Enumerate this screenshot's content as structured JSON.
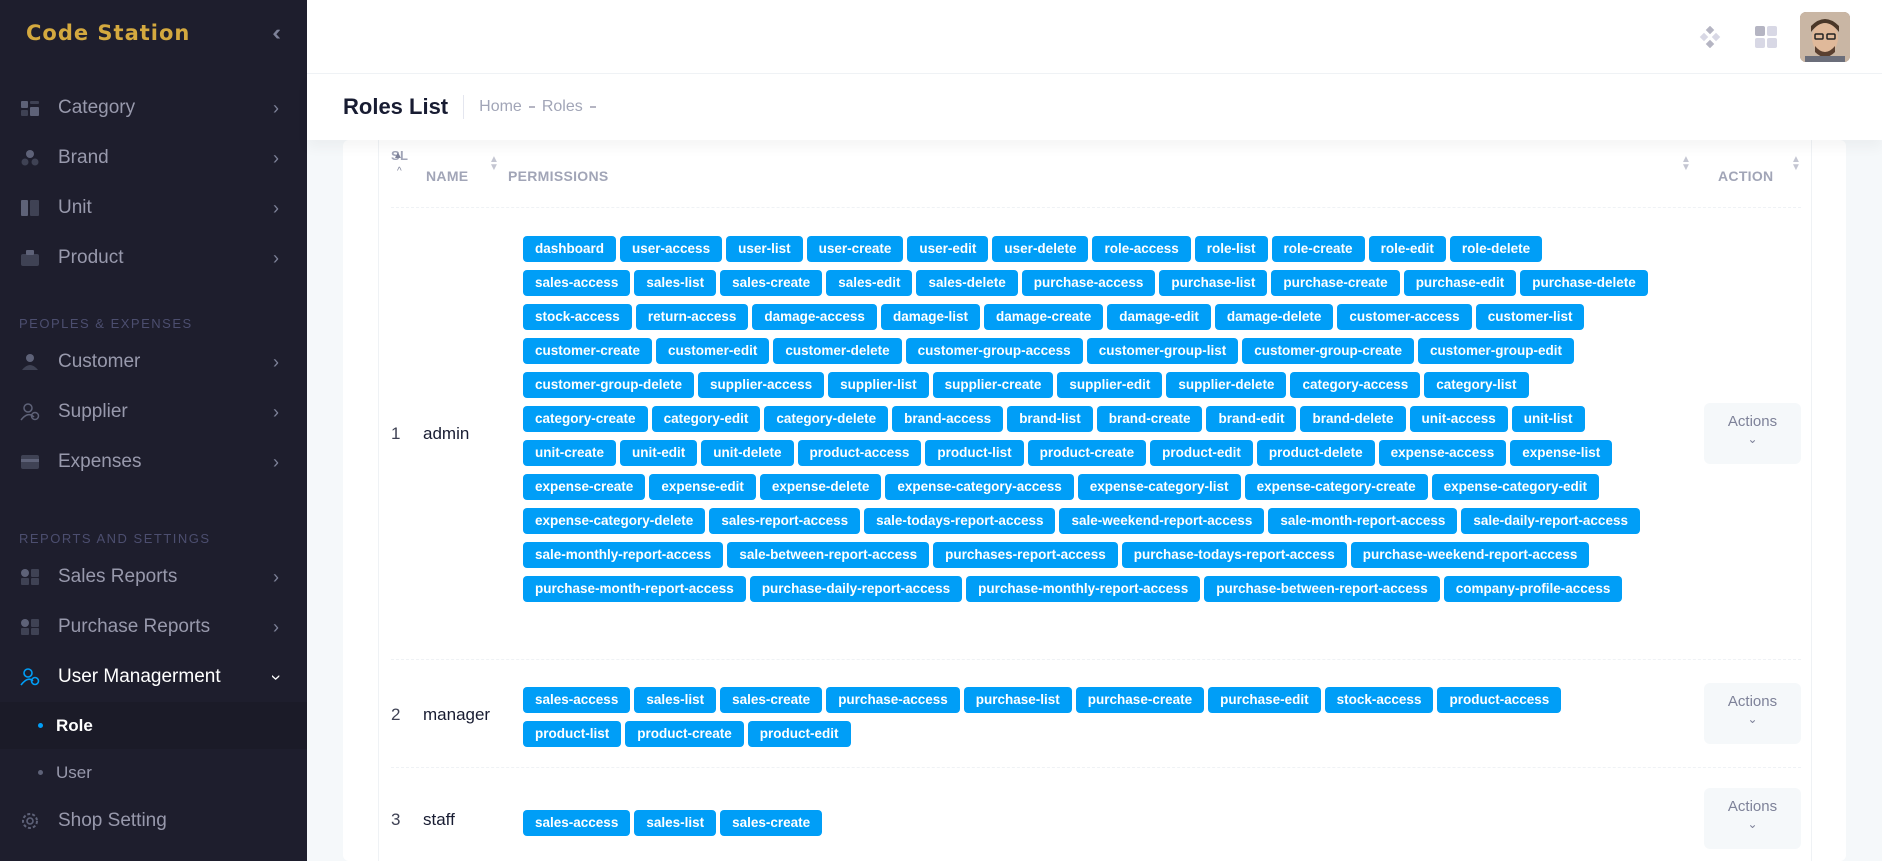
{
  "app": {
    "logo": "Code Station"
  },
  "sidebar": {
    "top_items": [
      {
        "label": "Category",
        "icon": "category-icon"
      },
      {
        "label": "Brand",
        "icon": "brand-icon"
      },
      {
        "label": "Unit",
        "icon": "unit-icon"
      },
      {
        "label": "Product",
        "icon": "product-icon"
      }
    ],
    "section1": "PEOPLES & EXPENSES",
    "people_items": [
      {
        "label": "Customer",
        "icon": "customer-icon"
      },
      {
        "label": "Supplier",
        "icon": "supplier-icon"
      },
      {
        "label": "Expenses",
        "icon": "expenses-icon"
      }
    ],
    "section2": "REPORTS AND SETTINGS",
    "report_items": [
      {
        "label": "Sales Reports",
        "icon": "sales-reports-icon"
      },
      {
        "label": "Purchase Reports",
        "icon": "purchase-reports-icon"
      }
    ],
    "user_management": {
      "label": "User Managerment",
      "sub": [
        {
          "label": "Role",
          "active": true
        },
        {
          "label": "User",
          "active": false
        }
      ]
    },
    "shop_setting": "Shop Setting"
  },
  "toolbar": {
    "title": "Roles List",
    "breadcrumb": [
      "Home",
      "Roles"
    ]
  },
  "table": {
    "headers": {
      "sl": "SL",
      "name": "NAME",
      "permissions": "PERMISSIONS",
      "action": "ACTION"
    },
    "action_label": "Actions",
    "rows": [
      {
        "sl": "1",
        "name": "admin",
        "permissions": [
          "dashboard",
          "user-access",
          "user-list",
          "user-create",
          "user-edit",
          "user-delete",
          "role-access",
          "role-list",
          "role-create",
          "role-edit",
          "role-delete",
          "sales-access",
          "sales-list",
          "sales-create",
          "sales-edit",
          "sales-delete",
          "purchase-access",
          "purchase-list",
          "purchase-create",
          "purchase-edit",
          "purchase-delete",
          "stock-access",
          "return-access",
          "damage-access",
          "damage-list",
          "damage-create",
          "damage-edit",
          "damage-delete",
          "customer-access",
          "customer-list",
          "customer-create",
          "customer-edit",
          "customer-delete",
          "customer-group-access",
          "customer-group-list",
          "customer-group-create",
          "customer-group-edit",
          "customer-group-delete",
          "supplier-access",
          "supplier-list",
          "supplier-create",
          "supplier-edit",
          "supplier-delete",
          "category-access",
          "category-list",
          "category-create",
          "category-edit",
          "category-delete",
          "brand-access",
          "brand-list",
          "brand-create",
          "brand-edit",
          "brand-delete",
          "unit-access",
          "unit-list",
          "unit-create",
          "unit-edit",
          "unit-delete",
          "product-access",
          "product-list",
          "product-create",
          "product-edit",
          "product-delete",
          "expense-access",
          "expense-list",
          "expense-create",
          "expense-edit",
          "expense-delete",
          "expense-category-access",
          "expense-category-list",
          "expense-category-create",
          "expense-category-edit",
          "expense-category-delete",
          "sales-report-access",
          "sale-todays-report-access",
          "sale-weekend-report-access",
          "sale-month-report-access",
          "sale-daily-report-access",
          "sale-monthly-report-access",
          "sale-between-report-access",
          "purchases-report-access",
          "purchase-todays-report-access",
          "purchase-weekend-report-access",
          "purchase-month-report-access",
          "purchase-daily-report-access",
          "purchase-monthly-report-access",
          "purchase-between-report-access",
          "company-profile-access"
        ]
      },
      {
        "sl": "2",
        "name": "manager",
        "permissions": [
          "sales-access",
          "sales-list",
          "sales-create",
          "purchase-access",
          "purchase-list",
          "purchase-create",
          "purchase-edit",
          "stock-access",
          "product-access",
          "product-list",
          "product-create",
          "product-edit"
        ]
      },
      {
        "sl": "3",
        "name": "staff",
        "permissions": [
          "sales-access",
          "sales-list",
          "sales-create"
        ]
      }
    ]
  }
}
